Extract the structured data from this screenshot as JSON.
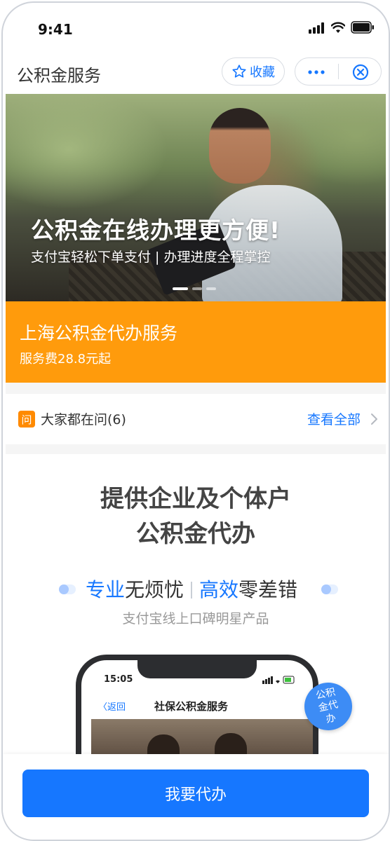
{
  "status_bar": {
    "time": "9:41"
  },
  "navbar": {
    "title": "公积金服务",
    "collect_label": "收藏"
  },
  "banner": {
    "headline": "公积金在线办理更方便!",
    "subline": "支付宝轻松下单支付 | 办理进度全程掌控",
    "slide_count": 3,
    "active_slide": 1
  },
  "service_card": {
    "title": "上海公积金代办服务",
    "subtitle": "服务费28.8元起"
  },
  "faq": {
    "badge": "问",
    "label": "大家都在问(6)",
    "view_all": "查看全部"
  },
  "promo": {
    "headline_line1": "提供企业及个体户",
    "headline_line2": "公积金代办",
    "slogan_a_blue": "专业",
    "slogan_a_rest": "无烦忧",
    "slogan_b_blue": "高效",
    "slogan_b_rest": "零差错",
    "tagline": "支付宝线上口碑明星产品",
    "mockup": {
      "time": "15:05",
      "back": "返回",
      "title": "社保公积金服务"
    },
    "bubble": "公积金代办"
  },
  "footer": {
    "cta": "我要代办"
  },
  "colors": {
    "accent": "#1677ff",
    "orange": "#ff9b0c"
  }
}
